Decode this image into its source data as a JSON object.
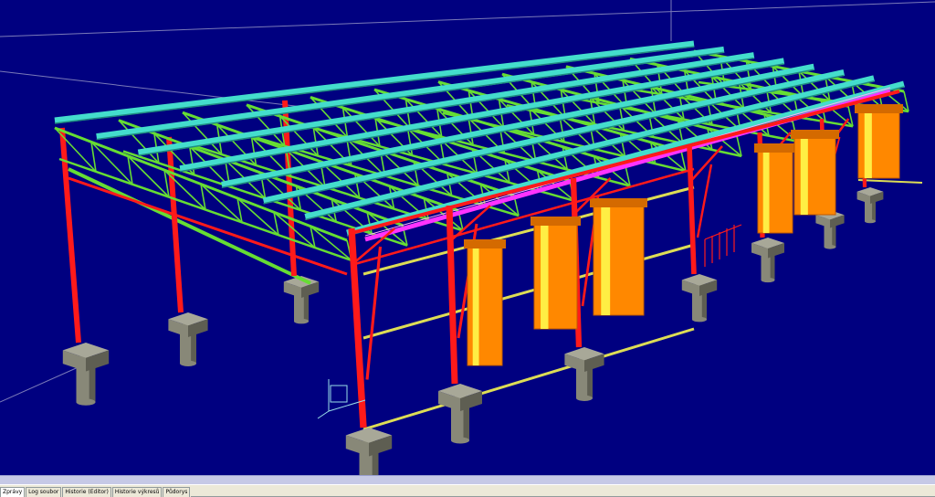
{
  "colors": {
    "background": "#000080",
    "column": "#ff1a1a",
    "truss": "#66dd33",
    "purlin": "#44ddcc",
    "brace_rail": "#dddd55",
    "panel": "#ff8800",
    "panel_stripe": "#ffee44",
    "magenta_beam": "#ff33ff",
    "concrete": "#888878",
    "concrete_dark": "#5e5e52"
  },
  "tabs": [
    {
      "label": "Zprávy",
      "active": true
    },
    {
      "label": "Log soubor",
      "active": false
    },
    {
      "label": "Historie (Editor)",
      "active": false
    },
    {
      "label": "Historie výkresů",
      "active": false
    },
    {
      "label": "Půdorys",
      "active": false
    }
  ]
}
